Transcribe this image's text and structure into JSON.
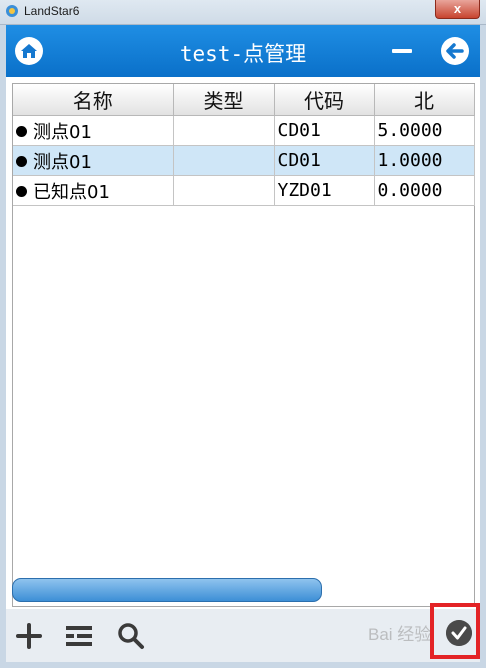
{
  "window": {
    "title": "LandStar6",
    "close_label": "x"
  },
  "appbar": {
    "title": "test-点管理"
  },
  "table": {
    "columns": [
      "名称",
      "类型",
      "代码",
      "北"
    ],
    "rows": [
      {
        "name": "测点01",
        "type": "",
        "code": "CD01",
        "north": "5.0000",
        "selected": false
      },
      {
        "name": "测点01",
        "type": "",
        "code": "CD01",
        "north": "1.0000",
        "selected": true
      },
      {
        "name": "已知点01",
        "type": "",
        "code": "YZD01",
        "north": "0.0000",
        "selected": false
      }
    ]
  },
  "toolbar": {
    "icons": [
      "plus-icon",
      "list-icon",
      "search-icon",
      "check-icon"
    ],
    "watermark": "Bai 经验"
  },
  "colors": {
    "appbar": "#0a70c9",
    "selected_row": "#cfe6f7",
    "highlight_box": "#e32326"
  }
}
